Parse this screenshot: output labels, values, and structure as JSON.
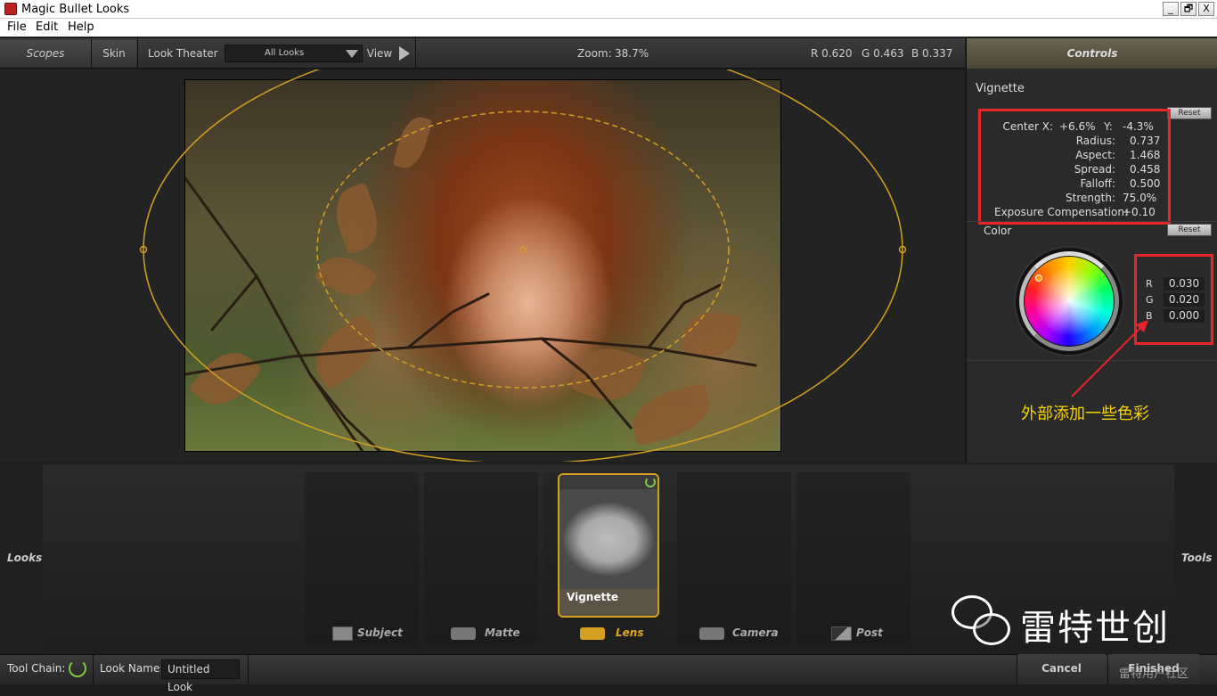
{
  "window": {
    "title": "Magic Bullet Looks",
    "min": "_",
    "max": "🗗",
    "close": "X"
  },
  "menu": [
    "File",
    "Edit",
    "Help"
  ],
  "toolbar": {
    "scopes": "Scopes",
    "skin": "Skin",
    "look_theater": "Look Theater",
    "look_filter": "All Looks",
    "view": "View",
    "zoom_label": "Zoom:",
    "zoom_value": "38.7%",
    "r": "R 0.620",
    "g": "G 0.463",
    "b": "B 0.337"
  },
  "controls": {
    "header": "Controls",
    "section": "Vignette",
    "reset": "Reset",
    "params": {
      "center_x_label": "Center X:",
      "center_x": "+6.6%",
      "y_label": "Y:",
      "y": "-4.3%",
      "radius_label": "Radius:",
      "radius": "0.737",
      "aspect_label": "Aspect:",
      "aspect": "1.468",
      "spread_label": "Spread:",
      "spread": "0.458",
      "falloff_label": "Falloff:",
      "falloff": "0.500",
      "strength_label": "Strength:",
      "strength": "75.0%",
      "exposure_label": "Exposure Compensation:",
      "exposure": "+0.10"
    },
    "color_label": "Color",
    "color_reset": "Reset",
    "rgb": {
      "r_label": "R",
      "r": "0.030",
      "g_label": "G",
      "g": "0.020",
      "b_label": "B",
      "b": "0.000"
    },
    "annotation": "外部添加一些色彩"
  },
  "tools": {
    "looks": "Looks",
    "tools": "Tools",
    "stages": [
      "Subject",
      "Matte",
      "Lens",
      "Camera",
      "Post"
    ],
    "active_stage": "Lens",
    "card_label": "Vignette"
  },
  "status": {
    "tool_chain": "Tool Chain:",
    "look_name_label": "Look Name:",
    "look_name": "Untitled Look",
    "cancel": "Cancel",
    "finished": "Finished"
  },
  "watermark": {
    "brand": "雷特世创",
    "sub": "雷特用户社区"
  },
  "colors": {
    "accent": "#d4a020",
    "annotation_red": "#e8262a",
    "annotation_text": "#f5d400"
  }
}
